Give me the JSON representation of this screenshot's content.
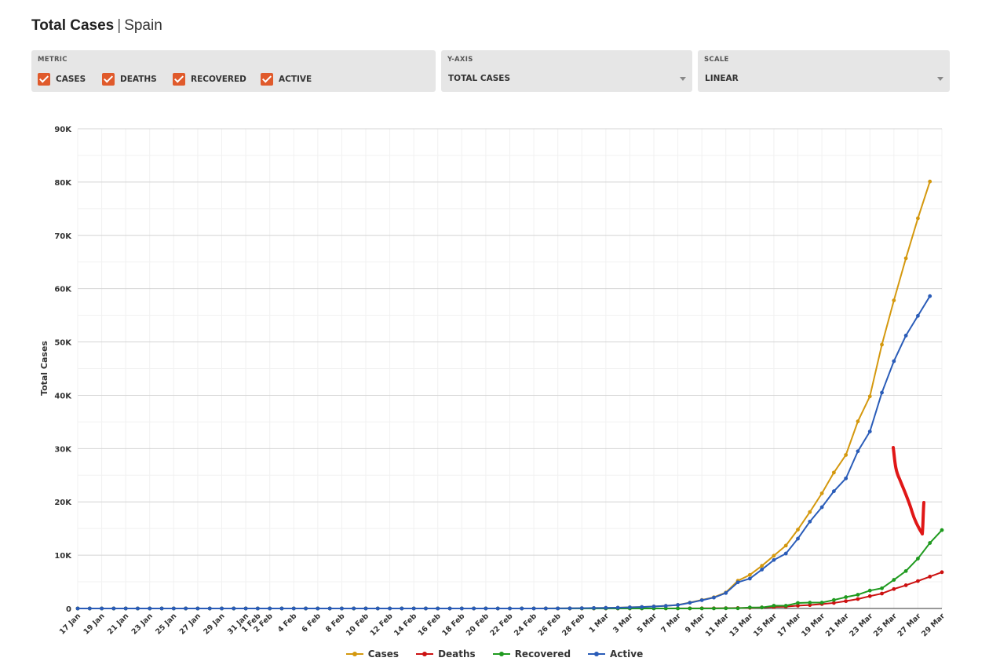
{
  "header": {
    "title": "Total Cases",
    "separator": "|",
    "subtitle": "Spain"
  },
  "controls": {
    "metric": {
      "label": "METRIC",
      "items": [
        {
          "label": "CASES",
          "checked": true
        },
        {
          "label": "DEATHS",
          "checked": true
        },
        {
          "label": "RECOVERED",
          "checked": true
        },
        {
          "label": "ACTIVE",
          "checked": true
        }
      ],
      "accent": "#e05a2b"
    },
    "yaxis": {
      "label": "Y-AXIS",
      "value": "TOTAL CASES"
    },
    "scale": {
      "label": "SCALE",
      "value": "LINEAR"
    }
  },
  "chart_data": {
    "type": "line",
    "ylabel": "Total Cases",
    "ylim": [
      0,
      90000
    ],
    "yticks": [
      "0",
      "10K",
      "20K",
      "30K",
      "40K",
      "50K",
      "60K",
      "70K",
      "80K",
      "90K"
    ],
    "yticks_values": [
      0,
      10000,
      20000,
      30000,
      40000,
      50000,
      60000,
      70000,
      80000,
      90000
    ],
    "grid": true,
    "legend_position": "bottom",
    "x": [
      "17 Jan",
      "18 Jan",
      "19 Jan",
      "20 Jan",
      "21 Jan",
      "22 Jan",
      "23 Jan",
      "24 Jan",
      "25 Jan",
      "26 Jan",
      "27 Jan",
      "28 Jan",
      "29 Jan",
      "30 Jan",
      "31 Jan",
      "1 Feb",
      "2 Feb",
      "3 Feb",
      "4 Feb",
      "5 Feb",
      "6 Feb",
      "7 Feb",
      "8 Feb",
      "9 Feb",
      "10 Feb",
      "11 Feb",
      "12 Feb",
      "13 Feb",
      "14 Feb",
      "15 Feb",
      "16 Feb",
      "17 Feb",
      "18 Feb",
      "19 Feb",
      "20 Feb",
      "21 Feb",
      "22 Feb",
      "23 Feb",
      "24 Feb",
      "25 Feb",
      "26 Feb",
      "27 Feb",
      "28 Feb",
      "29 Feb",
      "1 Mar",
      "2 Mar",
      "3 Mar",
      "4 Mar",
      "5 Mar",
      "6 Mar",
      "7 Mar",
      "8 Mar",
      "9 Mar",
      "10 Mar",
      "11 Mar",
      "12 Mar",
      "13 Mar",
      "14 Mar",
      "15 Mar",
      "16 Mar",
      "17 Mar",
      "18 Mar",
      "19 Mar",
      "20 Mar",
      "21 Mar",
      "22 Mar",
      "23 Mar",
      "24 Mar",
      "25 Mar",
      "26 Mar",
      "27 Mar",
      "28 Mar",
      "29 Mar"
    ],
    "xtick_labels": [
      "17 Jan",
      "19 Jan",
      "21 Jan",
      "23 Jan",
      "25 Jan",
      "27 Jan",
      "29 Jan",
      "31 Jan",
      "1 Feb",
      "2 Feb",
      "4 Feb",
      "6 Feb",
      "8 Feb",
      "10 Feb",
      "12 Feb",
      "14 Feb",
      "16 Feb",
      "18 Feb",
      "20 Feb",
      "22 Feb",
      "24 Feb",
      "26 Feb",
      "28 Feb",
      "1 Mar",
      "3 Mar",
      "5 Mar",
      "7 Mar",
      "9 Mar",
      "11 Mar",
      "13 Mar",
      "15 Mar",
      "17 Mar",
      "19 Mar",
      "21 Mar",
      "23 Mar",
      "25 Mar",
      "27 Mar",
      "29 Mar"
    ],
    "series": [
      {
        "name": "Cases",
        "color": "#d4980e",
        "values": [
          0,
          0,
          0,
          0,
          0,
          0,
          0,
          0,
          0,
          0,
          0,
          0,
          0,
          0,
          1,
          1,
          1,
          1,
          1,
          1,
          1,
          1,
          1,
          2,
          2,
          2,
          2,
          2,
          2,
          2,
          2,
          2,
          2,
          2,
          2,
          2,
          2,
          2,
          3,
          10,
          20,
          30,
          60,
          90,
          120,
          150,
          220,
          280,
          380,
          500,
          670,
          1100,
          1600,
          2100,
          3000,
          5200,
          6300,
          8000,
          9900,
          11800,
          14800,
          18100,
          21600,
          25500,
          28800,
          35100,
          39800,
          49500,
          57800,
          65700,
          73200,
          80100
        ]
      },
      {
        "name": "Deaths",
        "color": "#cc1111",
        "values": [
          0,
          0,
          0,
          0,
          0,
          0,
          0,
          0,
          0,
          0,
          0,
          0,
          0,
          0,
          0,
          0,
          0,
          0,
          0,
          0,
          0,
          0,
          0,
          0,
          0,
          0,
          0,
          0,
          0,
          0,
          0,
          0,
          0,
          0,
          0,
          0,
          0,
          0,
          0,
          0,
          0,
          0,
          0,
          0,
          0,
          0,
          0,
          2,
          3,
          5,
          10,
          17,
          28,
          35,
          54,
          84,
          120,
          190,
          290,
          340,
          530,
          640,
          830,
          1040,
          1380,
          1770,
          2310,
          2800,
          3650,
          4360,
          5140,
          5980,
          6800
        ]
      },
      {
        "name": "Recovered",
        "color": "#1f9a1f",
        "values": [
          0,
          0,
          0,
          0,
          0,
          0,
          0,
          0,
          0,
          0,
          0,
          0,
          0,
          0,
          0,
          0,
          0,
          0,
          0,
          0,
          0,
          0,
          0,
          0,
          0,
          2,
          2,
          2,
          2,
          2,
          2,
          2,
          2,
          2,
          2,
          2,
          2,
          2,
          2,
          2,
          2,
          2,
          2,
          2,
          2,
          2,
          2,
          2,
          2,
          2,
          2,
          2,
          2,
          2,
          30,
          30,
          190,
          190,
          520,
          520,
          1030,
          1100,
          1100,
          1590,
          2130,
          2580,
          3360,
          3790,
          5370,
          7020,
          9360,
          12290,
          14700
        ]
      },
      {
        "name": "Active",
        "color": "#2a5cb8",
        "values": [
          0,
          0,
          0,
          0,
          0,
          0,
          0,
          0,
          0,
          0,
          0,
          0,
          0,
          0,
          1,
          1,
          1,
          1,
          1,
          1,
          1,
          1,
          1,
          2,
          0,
          0,
          0,
          0,
          0,
          0,
          0,
          0,
          0,
          0,
          0,
          0,
          0,
          0,
          1,
          8,
          18,
          28,
          58,
          88,
          118,
          148,
          218,
          278,
          370,
          490,
          650,
          1070,
          1550,
          2040,
          2900,
          4900,
          5600,
          7300,
          9100,
          10300,
          13100,
          16300,
          19000,
          22000,
          24400,
          29500,
          33200,
          40500,
          46400,
          51200,
          54900,
          58600
        ]
      }
    ]
  }
}
